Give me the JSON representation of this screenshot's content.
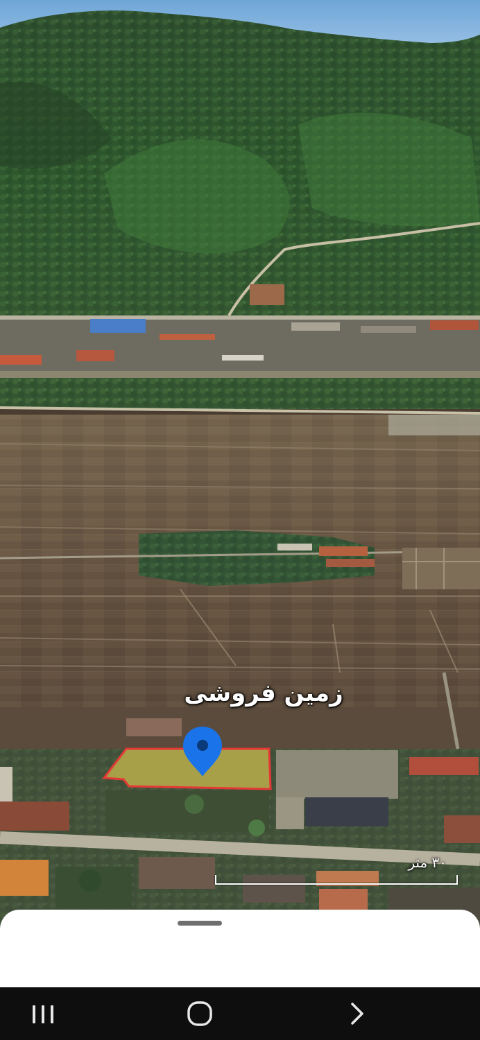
{
  "map": {
    "place_label": "زمین فروشی",
    "scale_label": "۳۰ متر",
    "pin_color": "#1a73e8",
    "boundary_color": "#e53935"
  },
  "navigation_bar": {
    "buttons": [
      "recent-apps",
      "home",
      "back"
    ]
  }
}
